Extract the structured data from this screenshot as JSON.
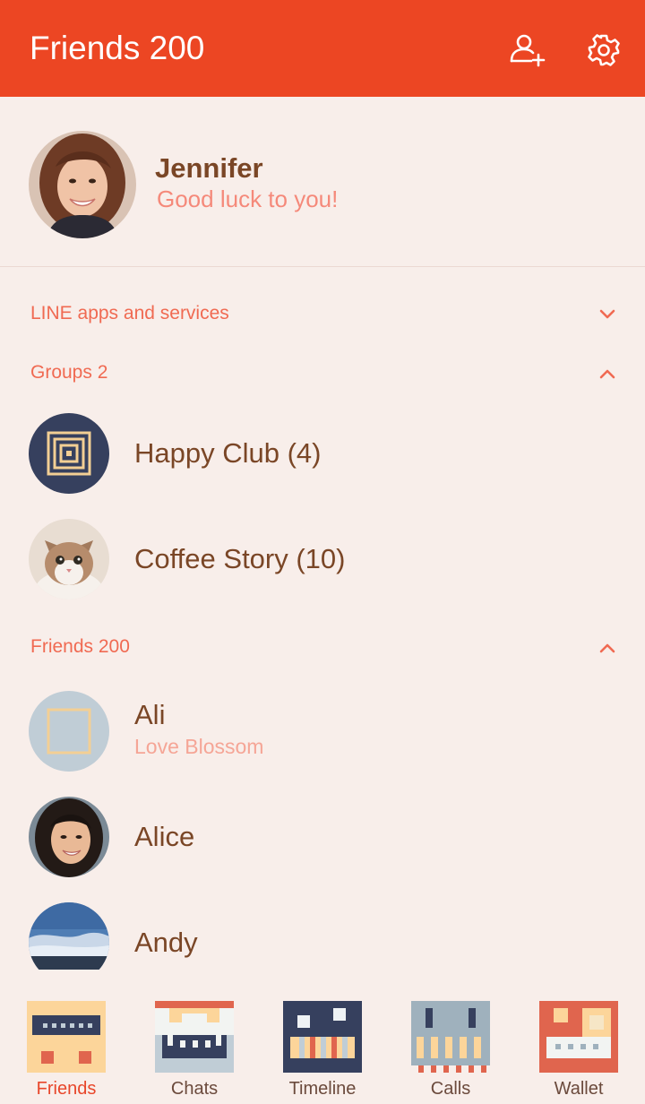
{
  "header": {
    "title": "Friends 200",
    "add_friend_icon": "person-add-icon",
    "settings_icon": "gear-icon"
  },
  "profile": {
    "name": "Jennifer",
    "status": "Good luck to you!"
  },
  "sections": {
    "services": {
      "label": "LINE apps and services",
      "expanded": false
    },
    "groups": {
      "label": "Groups 2",
      "expanded": true
    },
    "friends": {
      "label": "Friends 200",
      "expanded": true
    }
  },
  "groups": [
    {
      "name": "Happy Club (4)"
    },
    {
      "name": "Coffee Story (10)"
    }
  ],
  "friends": [
    {
      "name": "Ali",
      "status": "Love Blossom"
    },
    {
      "name": "Alice",
      "status": ""
    },
    {
      "name": "Andy",
      "status": ""
    }
  ],
  "tabs": [
    {
      "label": "Friends",
      "icon": "friends-tab-icon",
      "active": true
    },
    {
      "label": "Chats",
      "icon": "chats-tab-icon",
      "active": false
    },
    {
      "label": "Timeline",
      "icon": "timeline-tab-icon",
      "active": false
    },
    {
      "label": "Calls",
      "icon": "calls-tab-icon",
      "active": false
    },
    {
      "label": "Wallet",
      "icon": "wallet-tab-icon",
      "active": false
    }
  ],
  "colors": {
    "accent": "#ec4623",
    "background": "#f8eeea",
    "name_text": "#7a4626",
    "section_text": "#f06a52",
    "status_text": "#f5897a"
  }
}
